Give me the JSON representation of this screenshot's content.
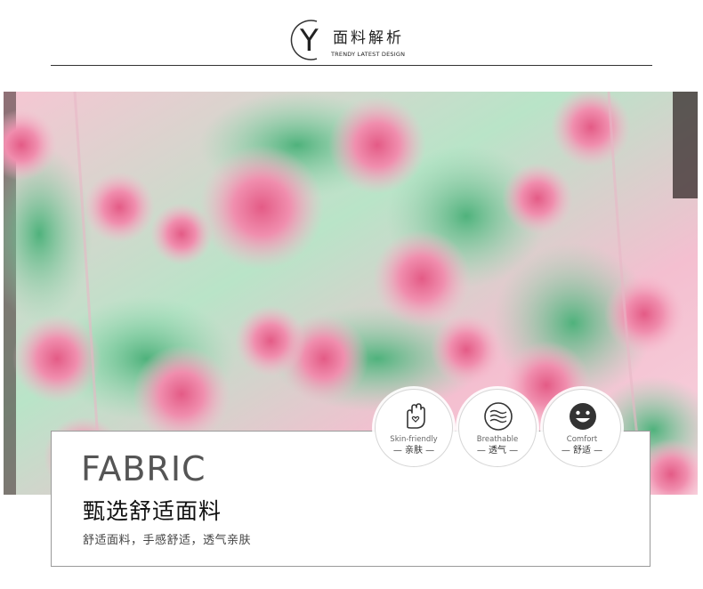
{
  "header": {
    "logo_letter": "Y",
    "title": "面料解析",
    "subtitle": "TRENDY LATEST DESIGN"
  },
  "photo": {
    "subject": "pink-rose-floral-print-fabric",
    "colors": {
      "pink": "#f4a9c0",
      "rose": "#e86b92",
      "green": "#7fcf9f",
      "light": "#fbd9e3"
    }
  },
  "card": {
    "title": "FABRIC",
    "heading": "甄选舒适面料",
    "description": "舒适面料，手感舒适，透气亲肤"
  },
  "badges": [
    {
      "icon": "hand-icon",
      "en": "Skin-friendly",
      "cn": "— 亲肤 —"
    },
    {
      "icon": "breathable-icon",
      "en": "Breathable",
      "cn": "— 透气 —"
    },
    {
      "icon": "smiley-icon",
      "en": "Comfort",
      "cn": "— 舒适 —"
    }
  ]
}
